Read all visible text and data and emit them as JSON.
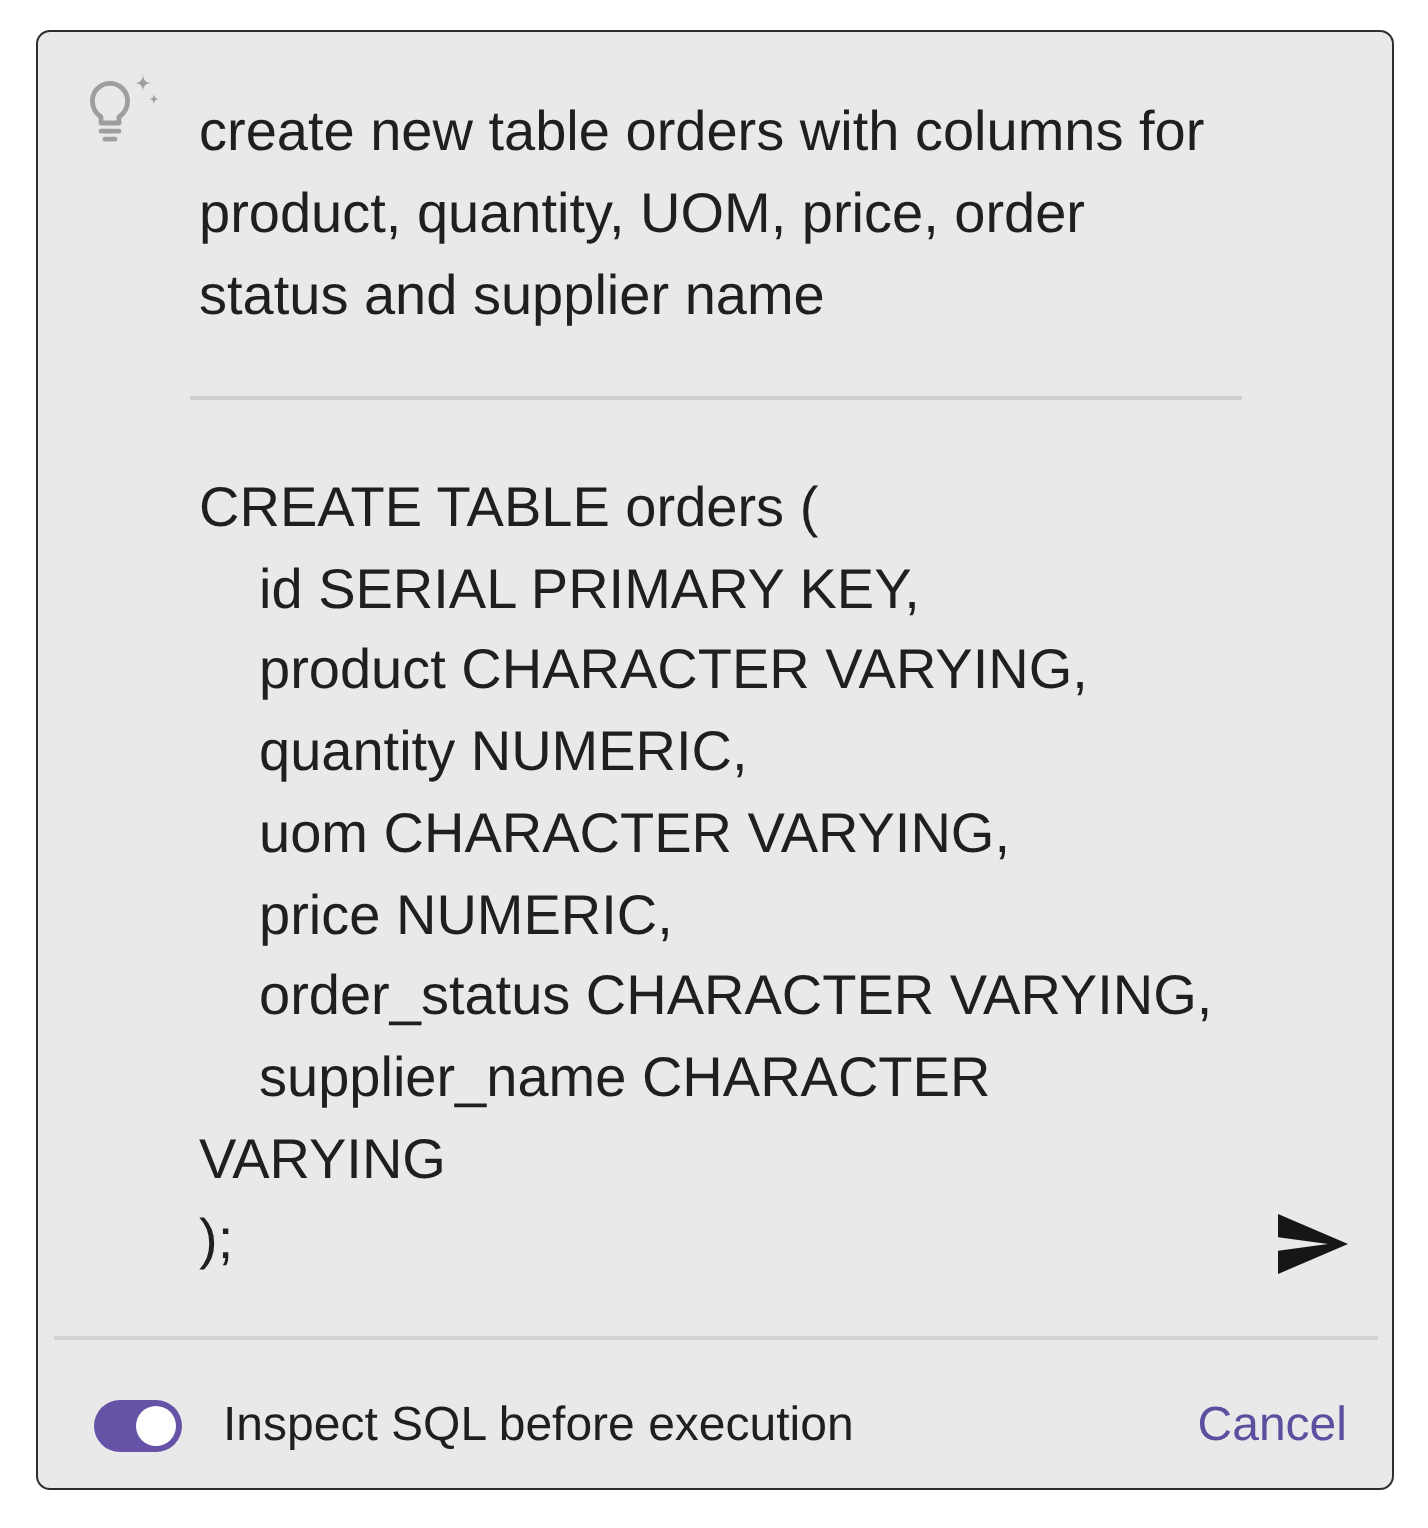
{
  "prompt": {
    "text": "create new table orders with columns for product, quantity, UOM, price, order status and supplier name"
  },
  "sql": {
    "lines": [
      {
        "text": "CREATE TABLE orders (",
        "children": [
          {
            "text": "id SERIAL PRIMARY KEY,"
          },
          {
            "text": "product CHARACTER VARYING,"
          },
          {
            "text": "quantity NUMERIC,"
          },
          {
            "text": "uom CHARACTER VARYING,"
          },
          {
            "text": "price NUMERIC,"
          },
          {
            "text": "order_status CHARACTER VARYING,"
          },
          {
            "text": "supplier_name CHARACTER"
          }
        ]
      },
      {
        "text": "VARYING"
      },
      {
        "text": ");"
      }
    ]
  },
  "footer": {
    "toggle": {
      "label": "Inspect SQL before execution",
      "on": true
    },
    "cancel": {
      "label": "Cancel"
    }
  }
}
